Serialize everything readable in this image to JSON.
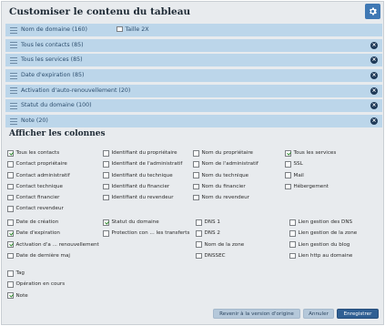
{
  "title": "Customiser le contenu du tableau",
  "rows": [
    {
      "label": "Nom de domaine (160)",
      "extra_label": "Taille 2X",
      "removable": false
    },
    {
      "label": "Tous les contacts (85)",
      "removable": true
    },
    {
      "label": "Tous les services (85)",
      "removable": true
    },
    {
      "label": "Date d'expiration (85)",
      "removable": true
    },
    {
      "label": "Activation d'auto-renouvellement (20)",
      "removable": true
    },
    {
      "label": "Statut du domaine (100)",
      "removable": true
    },
    {
      "label": "Note (20)",
      "removable": true
    }
  ],
  "columns_title": "Afficher les colonnes",
  "group1": {
    "col1": [
      {
        "label": "Tous les contacts",
        "checked": true
      },
      {
        "label": "Contact propriétaire",
        "checked": false
      },
      {
        "label": "Contact administratif",
        "checked": false
      },
      {
        "label": "Contact technique",
        "checked": false
      },
      {
        "label": "Contact financier",
        "checked": false
      },
      {
        "label": "Contact revendeur",
        "checked": false
      }
    ],
    "col2": [
      {
        "label": "Identifiant du propriétaire",
        "checked": false
      },
      {
        "label": "Identifiant de l'administratif",
        "checked": false
      },
      {
        "label": "Identifiant du technique",
        "checked": false
      },
      {
        "label": "Identifiant du financier",
        "checked": false
      },
      {
        "label": "Identifiant du revendeur",
        "checked": false
      }
    ],
    "col3": [
      {
        "label": "Nom du propriétaire",
        "checked": false
      },
      {
        "label": "Nom de l'administratif",
        "checked": false
      },
      {
        "label": "Nom du technique",
        "checked": false
      },
      {
        "label": "Nom du financier",
        "checked": false
      },
      {
        "label": "Nom du revendeur",
        "checked": false
      }
    ],
    "col4": [
      {
        "label": "Tous les services",
        "checked": true
      },
      {
        "label": "SSL",
        "checked": false
      },
      {
        "label": "Mail",
        "checked": false
      },
      {
        "label": "Hébergement",
        "checked": false
      }
    ]
  },
  "group2": {
    "col1": [
      {
        "label": "Date de création",
        "checked": false
      },
      {
        "label": "Date d'expiration",
        "checked": true
      },
      {
        "label": "Activation d'a ... renouvellement",
        "checked": true
      },
      {
        "label": "Date de dernière maj",
        "checked": false
      }
    ],
    "col2": [
      {
        "label": "Statut du domaine",
        "checked": true
      },
      {
        "label": "Protection con ... les transferts",
        "checked": false
      }
    ],
    "col3": [
      {
        "label": "DNS 1",
        "checked": false
      },
      {
        "label": "DNS 2",
        "checked": false
      },
      {
        "label": "Nom de la zone",
        "checked": false
      },
      {
        "label": "DNSSEC",
        "checked": false
      }
    ],
    "col4": [
      {
        "label": "Lien gestion des DNS",
        "checked": false
      },
      {
        "label": "Lien gestion de la zone",
        "checked": false
      },
      {
        "label": "Lien gestion du blog",
        "checked": false
      },
      {
        "label": "Lien http au domaine",
        "checked": false
      }
    ]
  },
  "group3": [
    {
      "label": "Tag",
      "checked": false
    },
    {
      "label": "Opération en cours",
      "checked": false
    },
    {
      "label": "Note",
      "checked": true
    }
  ],
  "buttons": {
    "reset": "Revenir à la version d'origine",
    "cancel": "Annuler",
    "save": "Enregistrer"
  },
  "icons": {
    "settings": "gear-icon",
    "remove": "remove-icon",
    "drag": "drag-handle-icon"
  },
  "colors": {
    "row_bg": "#bcd6ea",
    "primary": "#2f5f93",
    "check": "#2e8a2e"
  }
}
